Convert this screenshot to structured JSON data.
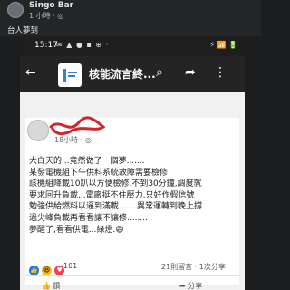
{
  "outer_post": {
    "author": "Singo Bar",
    "time": "1 小時",
    "caption": "台人夢到"
  },
  "status_bar": {
    "time": "15:17",
    "left_icons": "✉ ▲ ● ▪ ⊕ ·",
    "right_icons": "⚡ 📶 🔋"
  },
  "app_bar": {
    "title": "核能流言終..."
  },
  "post": {
    "time": "18小時 · ",
    "text": "大白天的...竟然做了一個夢.......\n某發電機組下午供料系統故障需要檢修.\n該機組降載10趴以方便檢修.不到30分鐘,調度就\n要求回升負載...電廠挺不住壓力,只好作假信號\n勉強供給燃料以逼到滿載.......異常運轉到晚上撐\n過尖峰負載再看看讓不讓修........\n夢醒了,看看供電...綠燈.😄",
    "reactions_count": "101",
    "comments": "21則留言 · 1次分享",
    "like_label": "讚",
    "share_label": "分享"
  },
  "colors": {
    "scribble": "#d6242c",
    "like": "#1877f2",
    "haha": "#f7b928"
  }
}
